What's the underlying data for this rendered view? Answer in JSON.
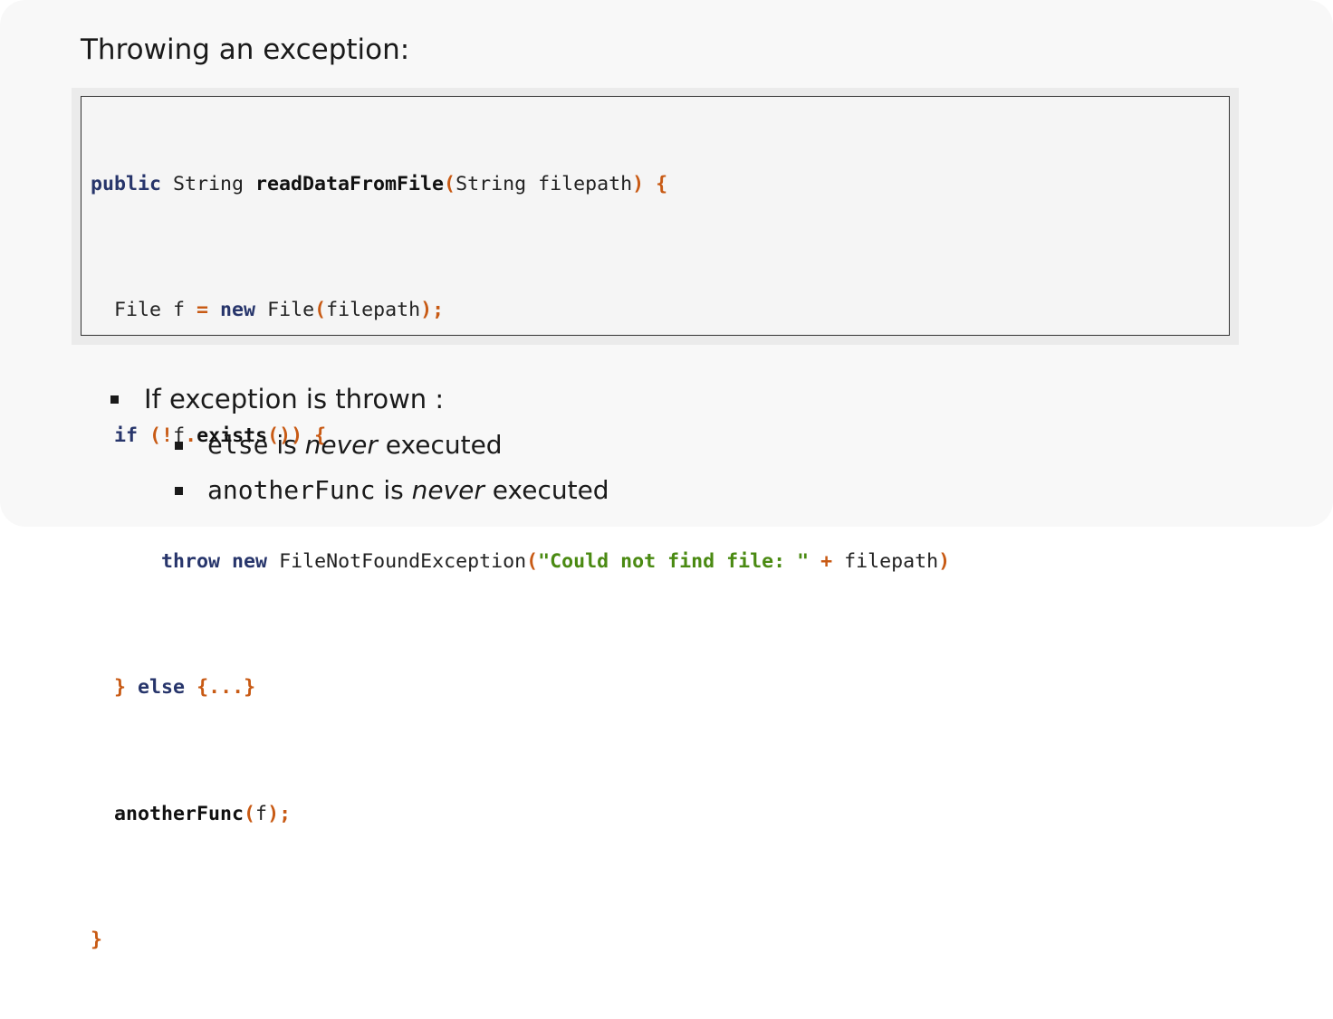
{
  "heading": "Throwing an exception:",
  "code": {
    "line1": {
      "kw_public": "public",
      "t1": " String ",
      "fn_name": "readDataFromFile",
      "p_open": "(",
      "t2": "String filepath",
      "p_close": ")",
      "t3": " ",
      "brace": "{"
    },
    "line2": {
      "indent": "  File f ",
      "eq": "=",
      "t1": " ",
      "kw_new": "new",
      "t2": " File",
      "p_open": "(",
      "t3": "filepath",
      "p_close": ");"
    },
    "line3": {
      "indent": "  ",
      "kw_if": "if",
      "t1": " ",
      "p_open": "(!",
      "t2": "f",
      "dot": ".",
      "fn_exists": "exists",
      "parens": "())",
      "t3": " ",
      "brace": "{"
    },
    "line4": {
      "indent": "      ",
      "kw_throw": "throw",
      "t1": " ",
      "kw_new": "new",
      "t2": " FileNotFoundException",
      "p_open": "(",
      "str": "\"Could not find file: \"",
      "t3": " ",
      "plus": "+",
      "t4": " filepath",
      "p_close": ")"
    },
    "line5": {
      "indent": "  ",
      "brace_close": "}",
      "t1": " ",
      "kw_else": "else",
      "t2": " ",
      "rest": "{...}"
    },
    "line6": {
      "indent": "  ",
      "fn_another": "anotherFunc",
      "p_open": "(",
      "t1": "f",
      "p_close": ");"
    },
    "line7": {
      "brace": "}"
    }
  },
  "bullets": {
    "main": "If exception is thrown :",
    "sub1": {
      "code": "else",
      "text1": " is ",
      "em": "never",
      "text2": " executed"
    },
    "sub2": {
      "code": "anotherFunc",
      "text1": " is ",
      "em": "never",
      "text2": " executed"
    }
  }
}
